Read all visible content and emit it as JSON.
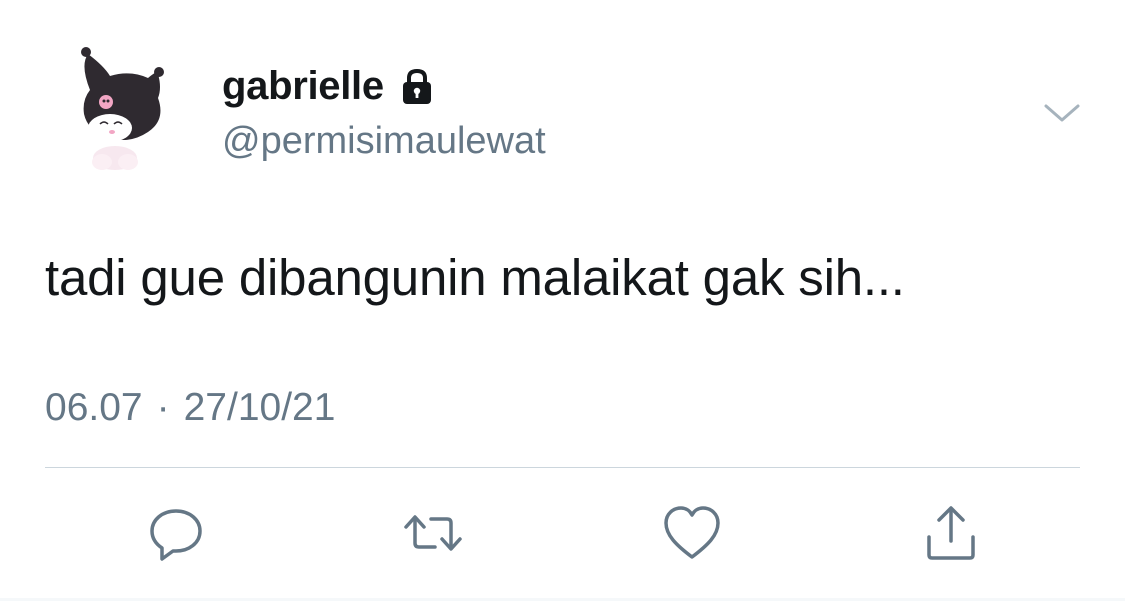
{
  "user": {
    "display_name": "gabrielle",
    "handle": "@permisimaulewat",
    "protected": true
  },
  "tweet": {
    "text": "tadi gue dibangunin malaikat gak sih...",
    "time": "06.07",
    "separator": "·",
    "date": "27/10/21"
  },
  "icons": {
    "avatar": "kuromi-avatar",
    "lock": "lock-icon",
    "more": "chevron-down-icon",
    "reply": "reply-icon",
    "retweet": "retweet-icon",
    "like": "heart-icon",
    "share": "share-icon"
  },
  "colors": {
    "text_primary": "#14171a",
    "text_secondary": "#657786",
    "icon": "#657786",
    "divider": "#ccd6dd"
  }
}
